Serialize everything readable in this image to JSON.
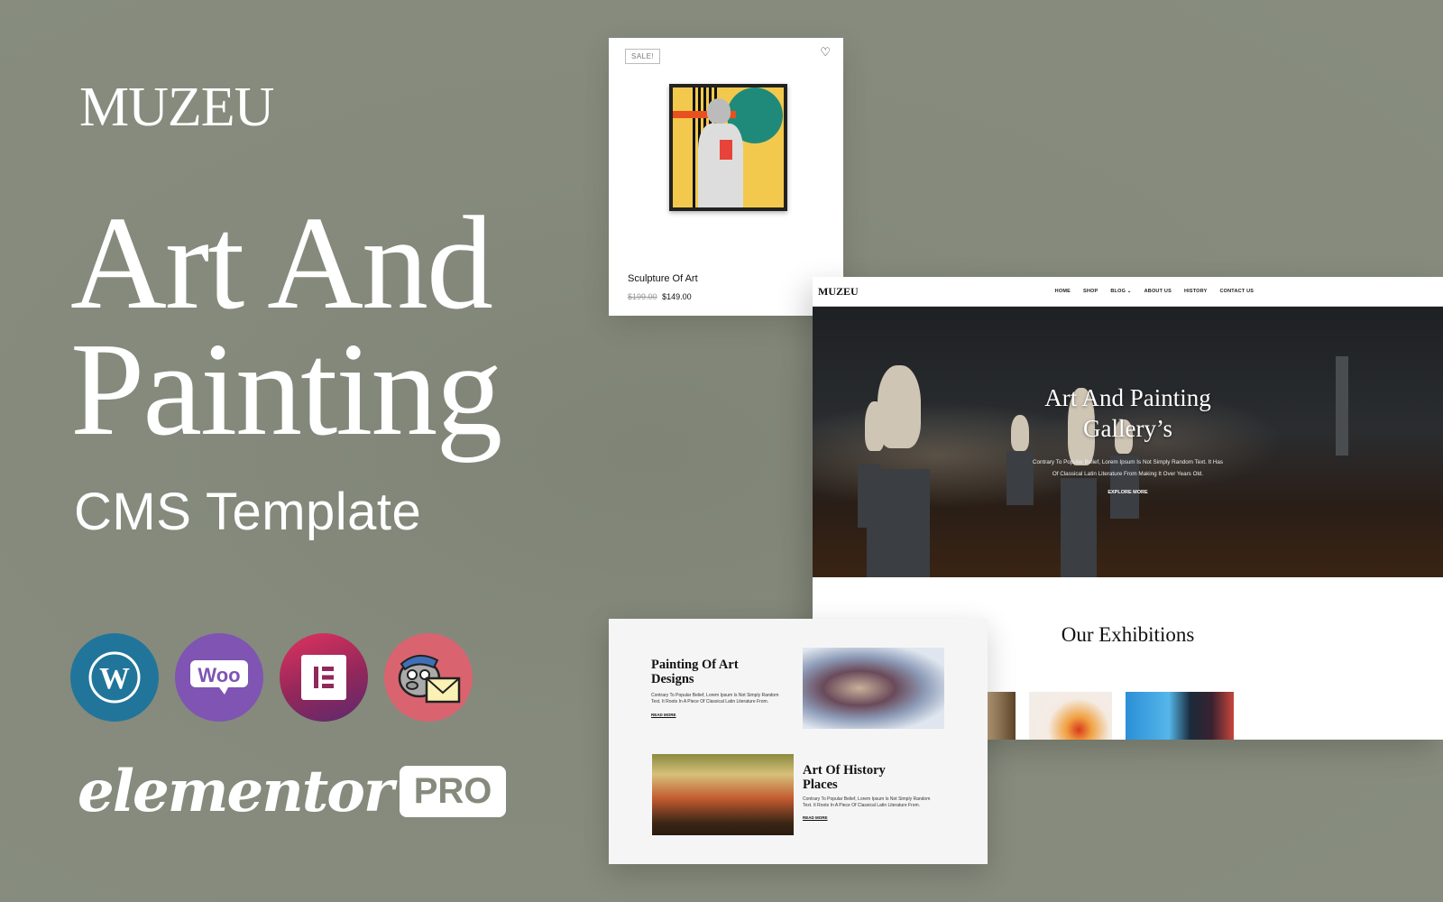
{
  "promo": {
    "brand": "MUZEU",
    "headline_line1": "Art And",
    "headline_line2": "Painting",
    "subhead": "CMS Template",
    "plugins": [
      {
        "name": "WordPress",
        "icon": "wordpress-icon",
        "color": "#21759b"
      },
      {
        "name": "WooCommerce",
        "icon": "woocommerce-icon",
        "label": "Woo",
        "color": "#7f54b3"
      },
      {
        "name": "Elementor",
        "icon": "elementor-icon",
        "color": "#e0335f"
      },
      {
        "name": "MailChimp",
        "icon": "mailchimp-icon",
        "color": "#d9646f"
      }
    ],
    "builder_word": "elementor",
    "builder_badge": "PRO"
  },
  "product_card": {
    "badge": "SALE!",
    "wishlist_icon": "heart-icon",
    "title": "Sculpture Of Art",
    "price_old": "$199.00",
    "price_new": "$149.00"
  },
  "website": {
    "logo": "MUZEU",
    "menu": [
      {
        "label": "HOME"
      },
      {
        "label": "SHOP"
      },
      {
        "label": "BLOG ⌄"
      },
      {
        "label": "ABOUT US"
      },
      {
        "label": "HISTORY"
      },
      {
        "label": "CONTACT US"
      }
    ],
    "hero": {
      "title_line1": "Art And Painting",
      "title_line2": "Gallery’s",
      "text_line1": "Contrary To Popular Belief, Lorem Ipsum Is Not Simply Random Text. It Has",
      "text_line2": "Of Classical Latin Literature From Making It Over Years Old.",
      "button": "EXPLORE MORE"
    },
    "exhibitions_title": "Our Exhibitions"
  },
  "feature_card": {
    "items": [
      {
        "title_line1": "Painting Of Art",
        "title_line2": "Designs",
        "text": "Contrary To Popular Belief, Lorem Ipsum Is Not Simply Random Text. It Roots In A Piece Of Classical Latin Literature From.",
        "link": "READ MORE"
      },
      {
        "title_line1": "Art Of History",
        "title_line2": "Places",
        "text": "Contrary To Popular Belief, Lorem Ipsum Is Not Simply Random Text. It Roots In A Piece Of Classical Latin Literature From.",
        "link": "READ MORE"
      }
    ]
  },
  "colors": {
    "background": "#858a7c",
    "text_light": "#ffffff",
    "text_dark": "#111111"
  }
}
